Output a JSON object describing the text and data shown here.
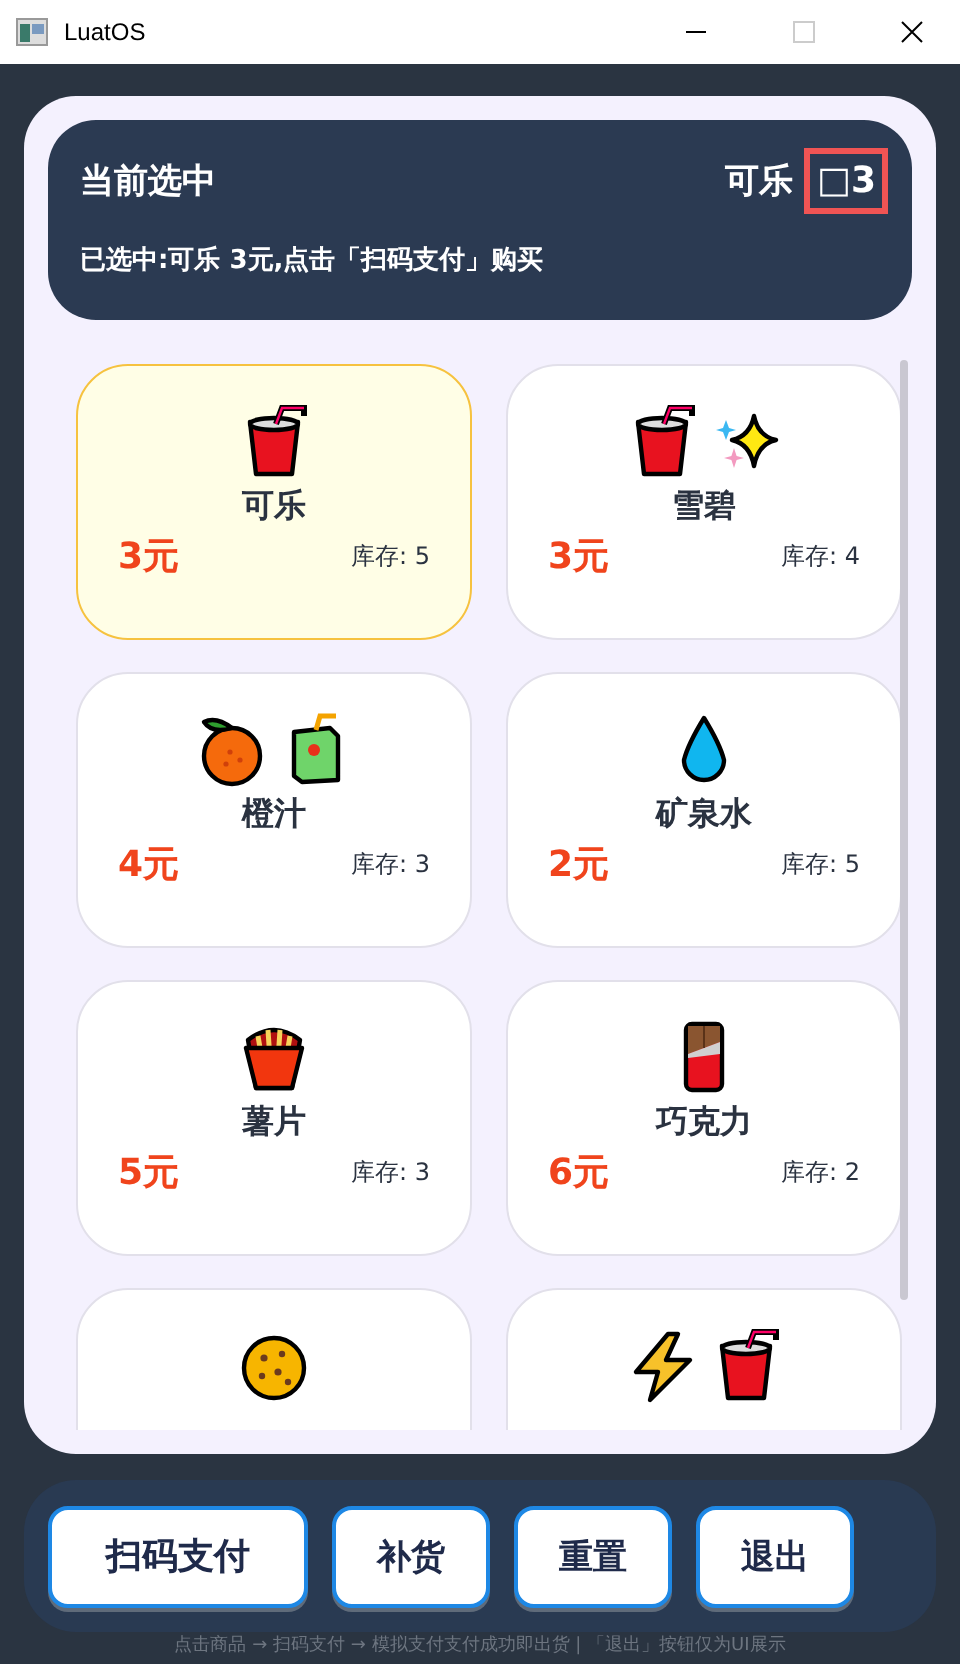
{
  "window": {
    "title": "LuatOS"
  },
  "header": {
    "title": "当前选中",
    "selected_name": "可乐",
    "badge": "□3",
    "badge_highlighted": true,
    "message": "已选中:可乐  3元,点击「扫码支付」购买"
  },
  "products": [
    {
      "name": "可乐",
      "price": "3元",
      "stock": "库存: 5",
      "selected": true,
      "kind": "cola"
    },
    {
      "name": "雪碧",
      "price": "3元",
      "stock": "库存: 4",
      "selected": false,
      "kind": "soda"
    },
    {
      "name": "橙汁",
      "price": "4元",
      "stock": "库存: 3",
      "selected": false,
      "kind": "juice"
    },
    {
      "name": "矿泉水",
      "price": "2元",
      "stock": "库存: 5",
      "selected": false,
      "kind": "water"
    },
    {
      "name": "薯片",
      "price": "5元",
      "stock": "库存: 3",
      "selected": false,
      "kind": "chips"
    },
    {
      "name": "巧克力",
      "price": "6元",
      "stock": "库存: 2",
      "selected": false,
      "kind": "chocolate"
    },
    {
      "selected": false,
      "kind": "cookie"
    },
    {
      "selected": false,
      "kind": "energy"
    }
  ],
  "buttons": [
    {
      "label": "扫码支付",
      "kind": "wide"
    },
    {
      "label": "补货",
      "kind": "normal"
    },
    {
      "label": "重置",
      "kind": "normal"
    },
    {
      "label": "退出",
      "kind": "normal"
    }
  ],
  "footer": "点击商品 → 扫码支付 → 模拟支付支付成功即出货 | 「退出」按钮仅为UI展示"
}
